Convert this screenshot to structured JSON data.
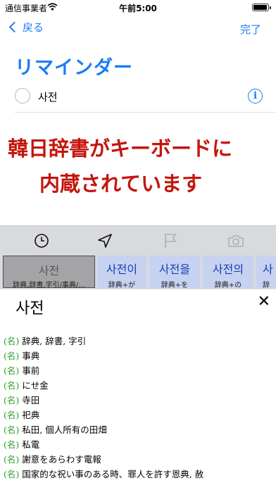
{
  "status_bar": {
    "carrier": "通信事業者",
    "time": "午前5:00"
  },
  "nav": {
    "back_label": "戻る",
    "done_label": "完了"
  },
  "list_title": "リマインダー",
  "reminder": {
    "text": "사전"
  },
  "banner": {
    "line1": "韓日辞書がキーボードに",
    "line2": "内蔵されています"
  },
  "toolbar": {
    "icons": [
      "clock-icon",
      "location-arrow-icon",
      "flag-icon",
      "camera-icon"
    ]
  },
  "candidates": [
    {
      "word": "사전",
      "sub": "辞典,辞書,字引/事典/...",
      "selected": true
    },
    {
      "word": "사전이",
      "sub": "辞典+が"
    },
    {
      "word": "사전을",
      "sub": "辞典+を"
    },
    {
      "word": "사전의",
      "sub": "辞典+の"
    },
    {
      "word": "사",
      "sub": "辞"
    }
  ],
  "dictionary": {
    "headword": "사전",
    "pos_label": "(名)",
    "definitions": [
      "辞典, 辞書, 字引",
      "事典",
      "事前",
      "にせ金",
      "寺田",
      "祀典",
      "私田, 個人所有の田畑",
      "私電",
      "謝意をあらわす電報",
      "国家的な祝い事のある時、罪人を許す恩典, 赦"
    ]
  },
  "colors": {
    "accent": "#1a7cf5",
    "banner": "#c4150d",
    "pos": "#2ba02b"
  }
}
